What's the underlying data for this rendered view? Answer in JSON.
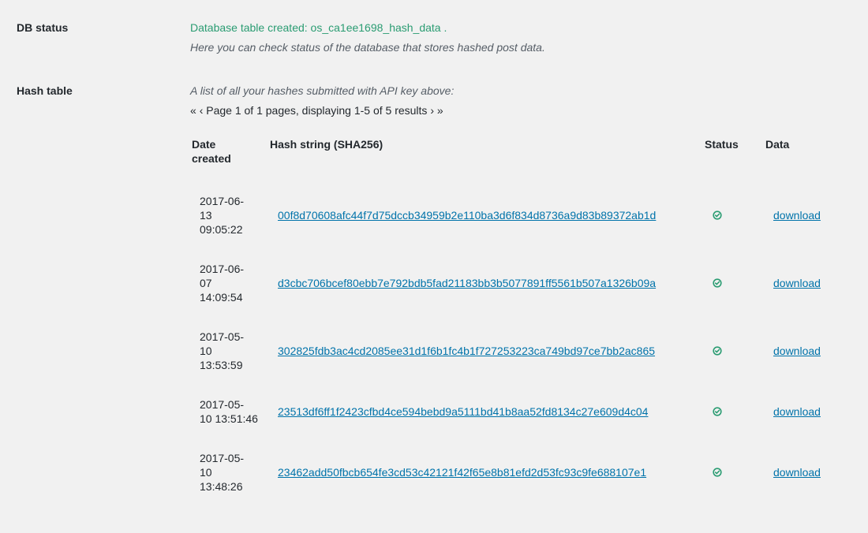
{
  "db_status": {
    "label": "DB status",
    "created_text": "Database table created: os_ca1ee1698_hash_data",
    "created_suffix": " .",
    "description": "Here you can check status of the database that stores hashed post data."
  },
  "hash_table": {
    "label": "Hash table",
    "description": "A list of all your hashes submitted with API key above:",
    "pagination": {
      "first": "«",
      "prev": "‹",
      "text": "Page 1 of 1 pages, displaying 1-5 of 5 results",
      "next": "›",
      "last": "»"
    },
    "columns": {
      "date": "Date created",
      "hash": "Hash string (SHA256)",
      "status": "Status",
      "data": "Data"
    },
    "rows": [
      {
        "date_line1": "2017-06-",
        "date_line2": "13",
        "date_line3": "09:05:22",
        "hash": "00f8d70608afc44f7d75dccb34959b2e110ba3d6f834d8736a9d83b89372ab1d",
        "status_icon": "check-circle-icon",
        "download": "download"
      },
      {
        "date_line1": "2017-06-",
        "date_line2": "07",
        "date_line3": "14:09:54",
        "hash": "d3cbc706bcef80ebb7e792bdb5fad21183bb3b5077891ff5561b507a1326b09a",
        "status_icon": "check-circle-icon",
        "download": "download"
      },
      {
        "date_line1": "2017-05-",
        "date_line2": "10",
        "date_line3": "13:53:59",
        "hash": "302825fdb3ac4cd2085ee31d1f6b1fc4b1f727253223ca749bd97ce7bb2ac865",
        "status_icon": "check-circle-icon",
        "download": "download"
      },
      {
        "date_line1": "2017-05-",
        "date_line2": "10 13:51:46",
        "date_line3": "",
        "hash": "23513df6ff1f2423cfbd4ce594bebd9a5111bd41b8aa52fd8134c27e609d4c04",
        "status_icon": "check-circle-icon",
        "download": "download"
      },
      {
        "date_line1": "2017-05-",
        "date_line2": "10",
        "date_line3": "13:48:26",
        "hash": "23462add50fbcb654fe3cd53c42121f42f65e8b81efd2d53fc93c9fe688107e1",
        "status_icon": "check-circle-icon",
        "download": "download"
      }
    ]
  },
  "colors": {
    "background": "#f1f1f1",
    "success": "#2a9c72",
    "link": "#0073aa",
    "text": "#23282d",
    "muted": "#555d66"
  }
}
